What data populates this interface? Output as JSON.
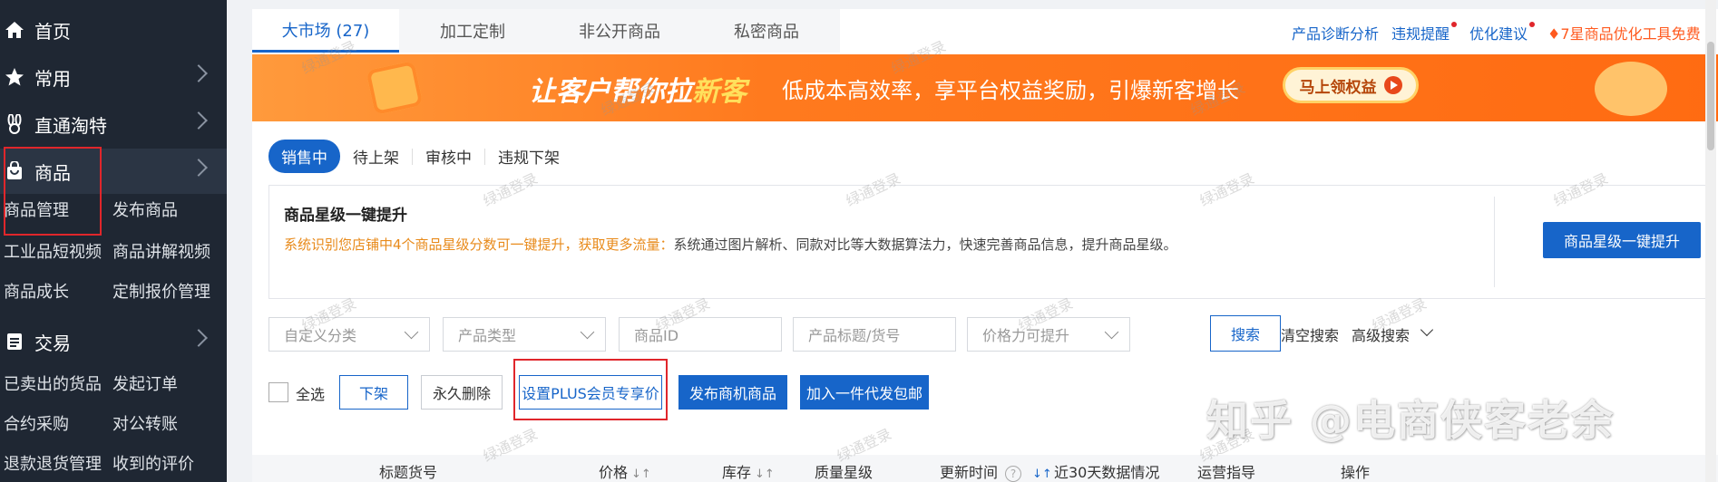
{
  "sidebar": {
    "items": [
      {
        "label": "首页",
        "icon": "home-icon"
      },
      {
        "label": "常用",
        "icon": "star-icon"
      },
      {
        "label": "直通淘特",
        "icon": "rabbit-icon"
      },
      {
        "label": "商品",
        "icon": "bag-icon"
      },
      {
        "label": "交易",
        "icon": "list-icon"
      }
    ],
    "goods_sub": [
      "商品管理",
      "发布商品",
      "工业品短视频",
      "商品讲解视频",
      "商品成长",
      "定制报价管理"
    ],
    "trade_sub": [
      "已卖出的货品",
      "发起订单",
      "合约采购",
      "对公转账",
      "退款退货管理",
      "收到的评价"
    ]
  },
  "tabs": [
    "大市场 (27)",
    "加工定制",
    "非公开商品",
    "私密商品"
  ],
  "top_links": {
    "diagnosis": "产品诊断分析",
    "violation": "违规提醒",
    "suggest": "优化建议",
    "tool": "7星商品优化工具免费"
  },
  "banner": {
    "headline_pre": "让客户帮你拉",
    "headline_hl": "新客",
    "sub": "低成本高效率，享平台权益奖励，引爆新客增长",
    "cta": "马上领权益"
  },
  "status_pills": [
    "销售中",
    "待上架",
    "审核中",
    "违规下架"
  ],
  "notice": {
    "title": "商品星级一键提升",
    "warn": "系统识别您店铺中4个商品星级分数可一键提升，获取更多流量：",
    "desc": "系统通过图片解析、同款对比等大数据算法力，快速完善商品信息，提升商品星级。",
    "button": "商品星级一键提升"
  },
  "filters": {
    "category": "自定义分类",
    "type": "产品类型",
    "id": "商品ID",
    "title": "产品标题/货号",
    "price": "价格力可提升",
    "search": "搜索",
    "clear": "清空搜索",
    "advanced": "高级搜索"
  },
  "actions": {
    "select_all": "全选",
    "offline": "下架",
    "delete": "永久删除",
    "plus": "设置PLUS会员专享价",
    "publish_opportunity": "发布商机商品",
    "dropship": "加入一件代发包邮"
  },
  "table_headers": {
    "title": "标题货号",
    "price": "价格",
    "stock": "库存",
    "quality": "质量星级",
    "updated": "更新时间",
    "recent30": "近30天数据情况",
    "ops_guide": "运营指导",
    "operate": "操作"
  },
  "watermark": "绿通登录",
  "zhihu_mark": "知乎 @电商侠客老余",
  "colors": {
    "accent": "#1765c9",
    "sidebar": "#1f2733",
    "warn": "#e88a1a",
    "highlight_box": "#e0262b"
  }
}
